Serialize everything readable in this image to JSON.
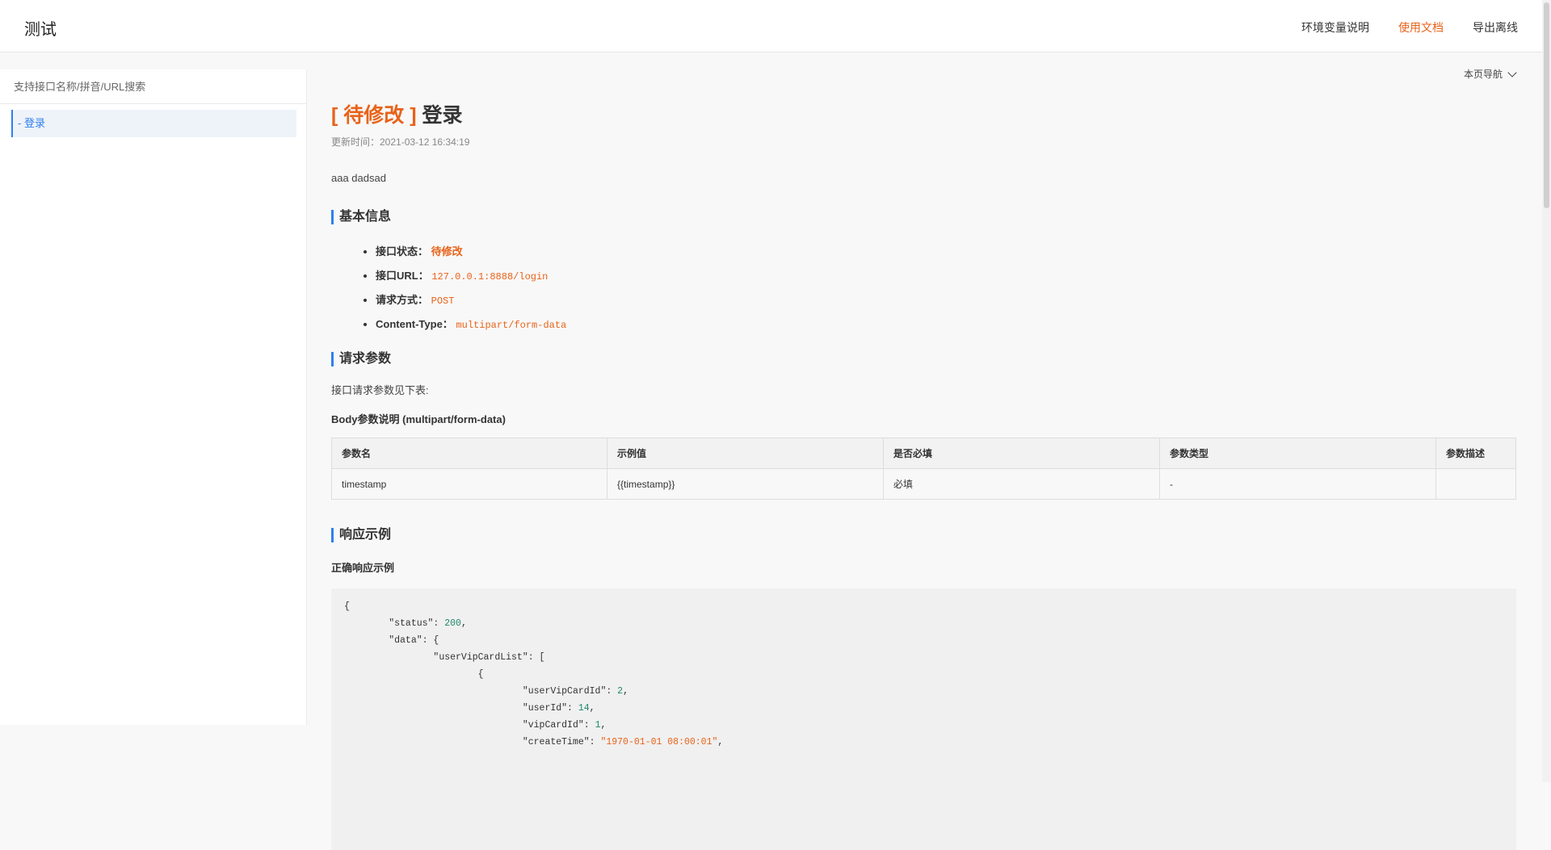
{
  "header": {
    "title": "测试",
    "nav": [
      "环境变量说明",
      "使用文档",
      "导出离线"
    ]
  },
  "sidebar": {
    "search_placeholder": "支持接口名称/拼音/URL搜索",
    "items": [
      {
        "label": "- 登录"
      }
    ]
  },
  "page_nav": "本页导航",
  "doc": {
    "status_tag": "[ 待修改 ]",
    "title": "登录",
    "updated": "更新时间：2021-03-12 16:34:19",
    "description": "aaa dadsad"
  },
  "basic": {
    "heading": "基本信息",
    "items": [
      {
        "key": "接口状态：",
        "value": "待修改"
      },
      {
        "key": "接口URL：",
        "value": "127.0.0.1:8888/login"
      },
      {
        "key": "请求方式：",
        "value": "POST"
      },
      {
        "key": "Content-Type：",
        "value": "multipart/form-data"
      }
    ]
  },
  "params": {
    "heading": "请求参数",
    "intro": "接口请求参数见下表:",
    "subheading": "Body参数说明 (multipart/form-data)",
    "columns": [
      "参数名",
      "示例值",
      "是否必填",
      "参数类型",
      "参数描述"
    ],
    "rows": [
      [
        "timestamp",
        "{{timestamp}}",
        "必填",
        "-",
        ""
      ]
    ]
  },
  "response": {
    "heading": "响应示例",
    "subheading": "正确响应示例"
  },
  "colors": {
    "accent": "#e8631a",
    "brand_blue": "#2f80ed"
  }
}
